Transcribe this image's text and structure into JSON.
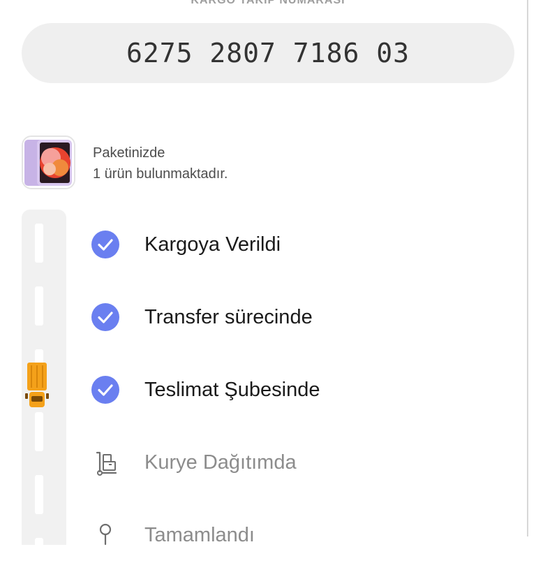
{
  "tracking": {
    "label": "KARGO TAKİP NUMARASI",
    "number": "6275 2807 7186 03"
  },
  "package": {
    "line1": "Paketinizde",
    "line2": "1 ürün bulunmaktadır."
  },
  "steps": [
    {
      "label": "Kargoya Verildi",
      "status": "done",
      "icon": "check-circle-icon"
    },
    {
      "label": "Transfer sürecinde",
      "status": "done",
      "icon": "check-circle-icon"
    },
    {
      "label": "Teslimat Şubesinde",
      "status": "done",
      "icon": "check-circle-icon"
    },
    {
      "label": "Kurye Dağıtımda",
      "status": "pending",
      "icon": "hand-truck-icon"
    },
    {
      "label": "Tamamlandı",
      "status": "pending",
      "icon": "location-pin-icon"
    }
  ],
  "colors": {
    "accent": "#6a7ff0",
    "truck": "#f4a11a",
    "pending": "#8c8c8c"
  }
}
